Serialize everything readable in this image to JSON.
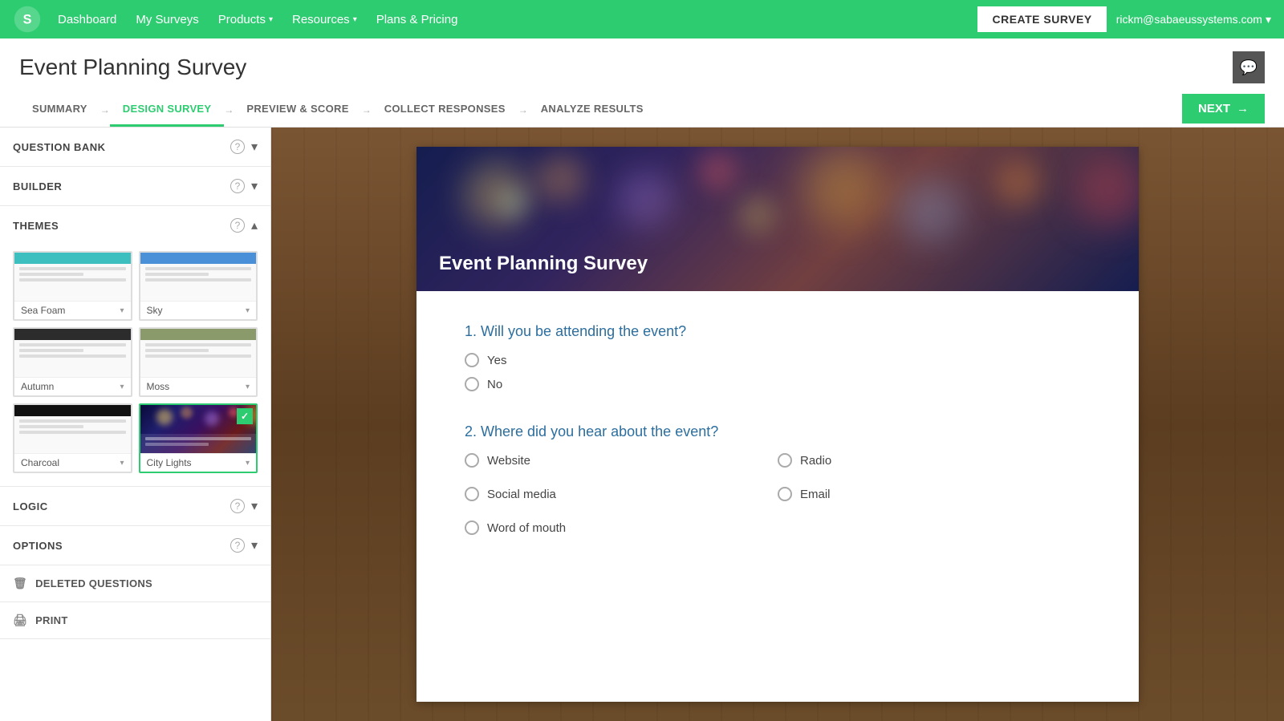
{
  "topnav": {
    "links": [
      {
        "label": "Dashboard",
        "hasDropdown": false
      },
      {
        "label": "My Surveys",
        "hasDropdown": false
      },
      {
        "label": "Products",
        "hasDropdown": true
      },
      {
        "label": "Resources",
        "hasDropdown": true
      },
      {
        "label": "Plans & Pricing",
        "hasDropdown": false
      }
    ],
    "create_survey_label": "CREATE SURVEY",
    "user_email": "rickm@sabaeussystems.com"
  },
  "page": {
    "title": "Event Planning Survey",
    "chat_icon": "💬"
  },
  "tabs": [
    {
      "label": "SUMMARY",
      "active": false
    },
    {
      "label": "DESIGN SURVEY",
      "active": true
    },
    {
      "label": "PREVIEW & SCORE",
      "active": false
    },
    {
      "label": "COLLECT RESPONSES",
      "active": false
    },
    {
      "label": "ANALYZE RESULTS",
      "active": false
    }
  ],
  "next_button_label": "NEXT",
  "sidebar": {
    "sections": [
      {
        "id": "question-bank",
        "title": "QUESTION BANK",
        "collapsed": true,
        "showHelp": true
      },
      {
        "id": "builder",
        "title": "BUILDER",
        "collapsed": true,
        "showHelp": true
      },
      {
        "id": "themes",
        "title": "THEMES",
        "collapsed": false,
        "showHelp": true
      }
    ],
    "themes": [
      {
        "id": "seafoam",
        "name": "Sea Foam",
        "headerClass": "seafoam-header",
        "selected": false
      },
      {
        "id": "sky",
        "name": "Sky",
        "headerClass": "sky-header",
        "selected": false
      },
      {
        "id": "autumn",
        "name": "Autumn",
        "headerClass": "autumn-header",
        "selected": false
      },
      {
        "id": "moss",
        "name": "Moss",
        "headerClass": "moss-header",
        "selected": false
      },
      {
        "id": "charcoal",
        "name": "Charcoal",
        "headerClass": "charcoal-header",
        "selected": false
      },
      {
        "id": "citylights",
        "name": "City Lights",
        "headerClass": "citylights-header",
        "selected": true
      }
    ],
    "bottom_sections": [
      {
        "id": "logic",
        "title": "LOGIC",
        "showHelp": true
      },
      {
        "id": "options",
        "title": "OPTIONS",
        "showHelp": true
      }
    ],
    "extra_items": [
      {
        "id": "deleted-questions",
        "title": "DELETED QUESTIONS",
        "icon": "🗑"
      },
      {
        "id": "print",
        "title": "PRINT",
        "icon": "🖨"
      }
    ]
  },
  "survey": {
    "title": "Event Planning Survey",
    "questions": [
      {
        "number": 1,
        "text": "Will you be attending the event?",
        "type": "radio",
        "options": [
          {
            "label": "Yes"
          },
          {
            "label": "No"
          }
        ]
      },
      {
        "number": 2,
        "text": "Where did you hear about the event?",
        "type": "radio-columns",
        "col1": [
          {
            "label": "Website"
          },
          {
            "label": "Social media"
          },
          {
            "label": "Word of mouth"
          }
        ],
        "col2": [
          {
            "label": "Radio"
          },
          {
            "label": "Email"
          }
        ]
      }
    ]
  }
}
